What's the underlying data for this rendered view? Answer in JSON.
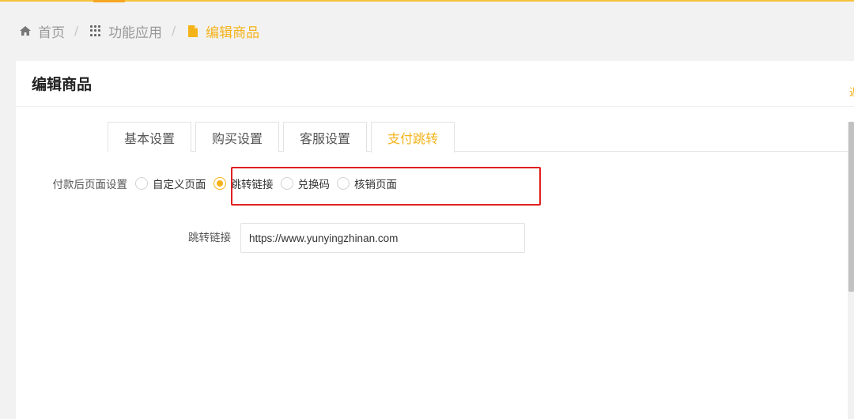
{
  "breadcrumb": {
    "home": "首页",
    "apps": "功能应用",
    "current": "编辑商品",
    "separator": "/",
    "icons": {
      "home": "home-icon",
      "apps": "grid-icon",
      "current": "file-icon"
    }
  },
  "card": {
    "title": "编辑商品",
    "right_glyph": "返"
  },
  "tabs": [
    {
      "label": "基本设置"
    },
    {
      "label": "购买设置"
    },
    {
      "label": "客服设置"
    },
    {
      "label": "支付跳转",
      "active": true
    }
  ],
  "form": {
    "after_payment": {
      "label": "付款后页面设置",
      "options": [
        "自定义页面",
        "跳转链接",
        "兑换码",
        "核销页面"
      ],
      "selected": "跳转链接"
    },
    "jump_link": {
      "label": "跳转链接",
      "value": "https://www.yunyingzhinan.com"
    }
  },
  "colors": {
    "accent": "#f5b31a",
    "highlight": "#e02020"
  }
}
